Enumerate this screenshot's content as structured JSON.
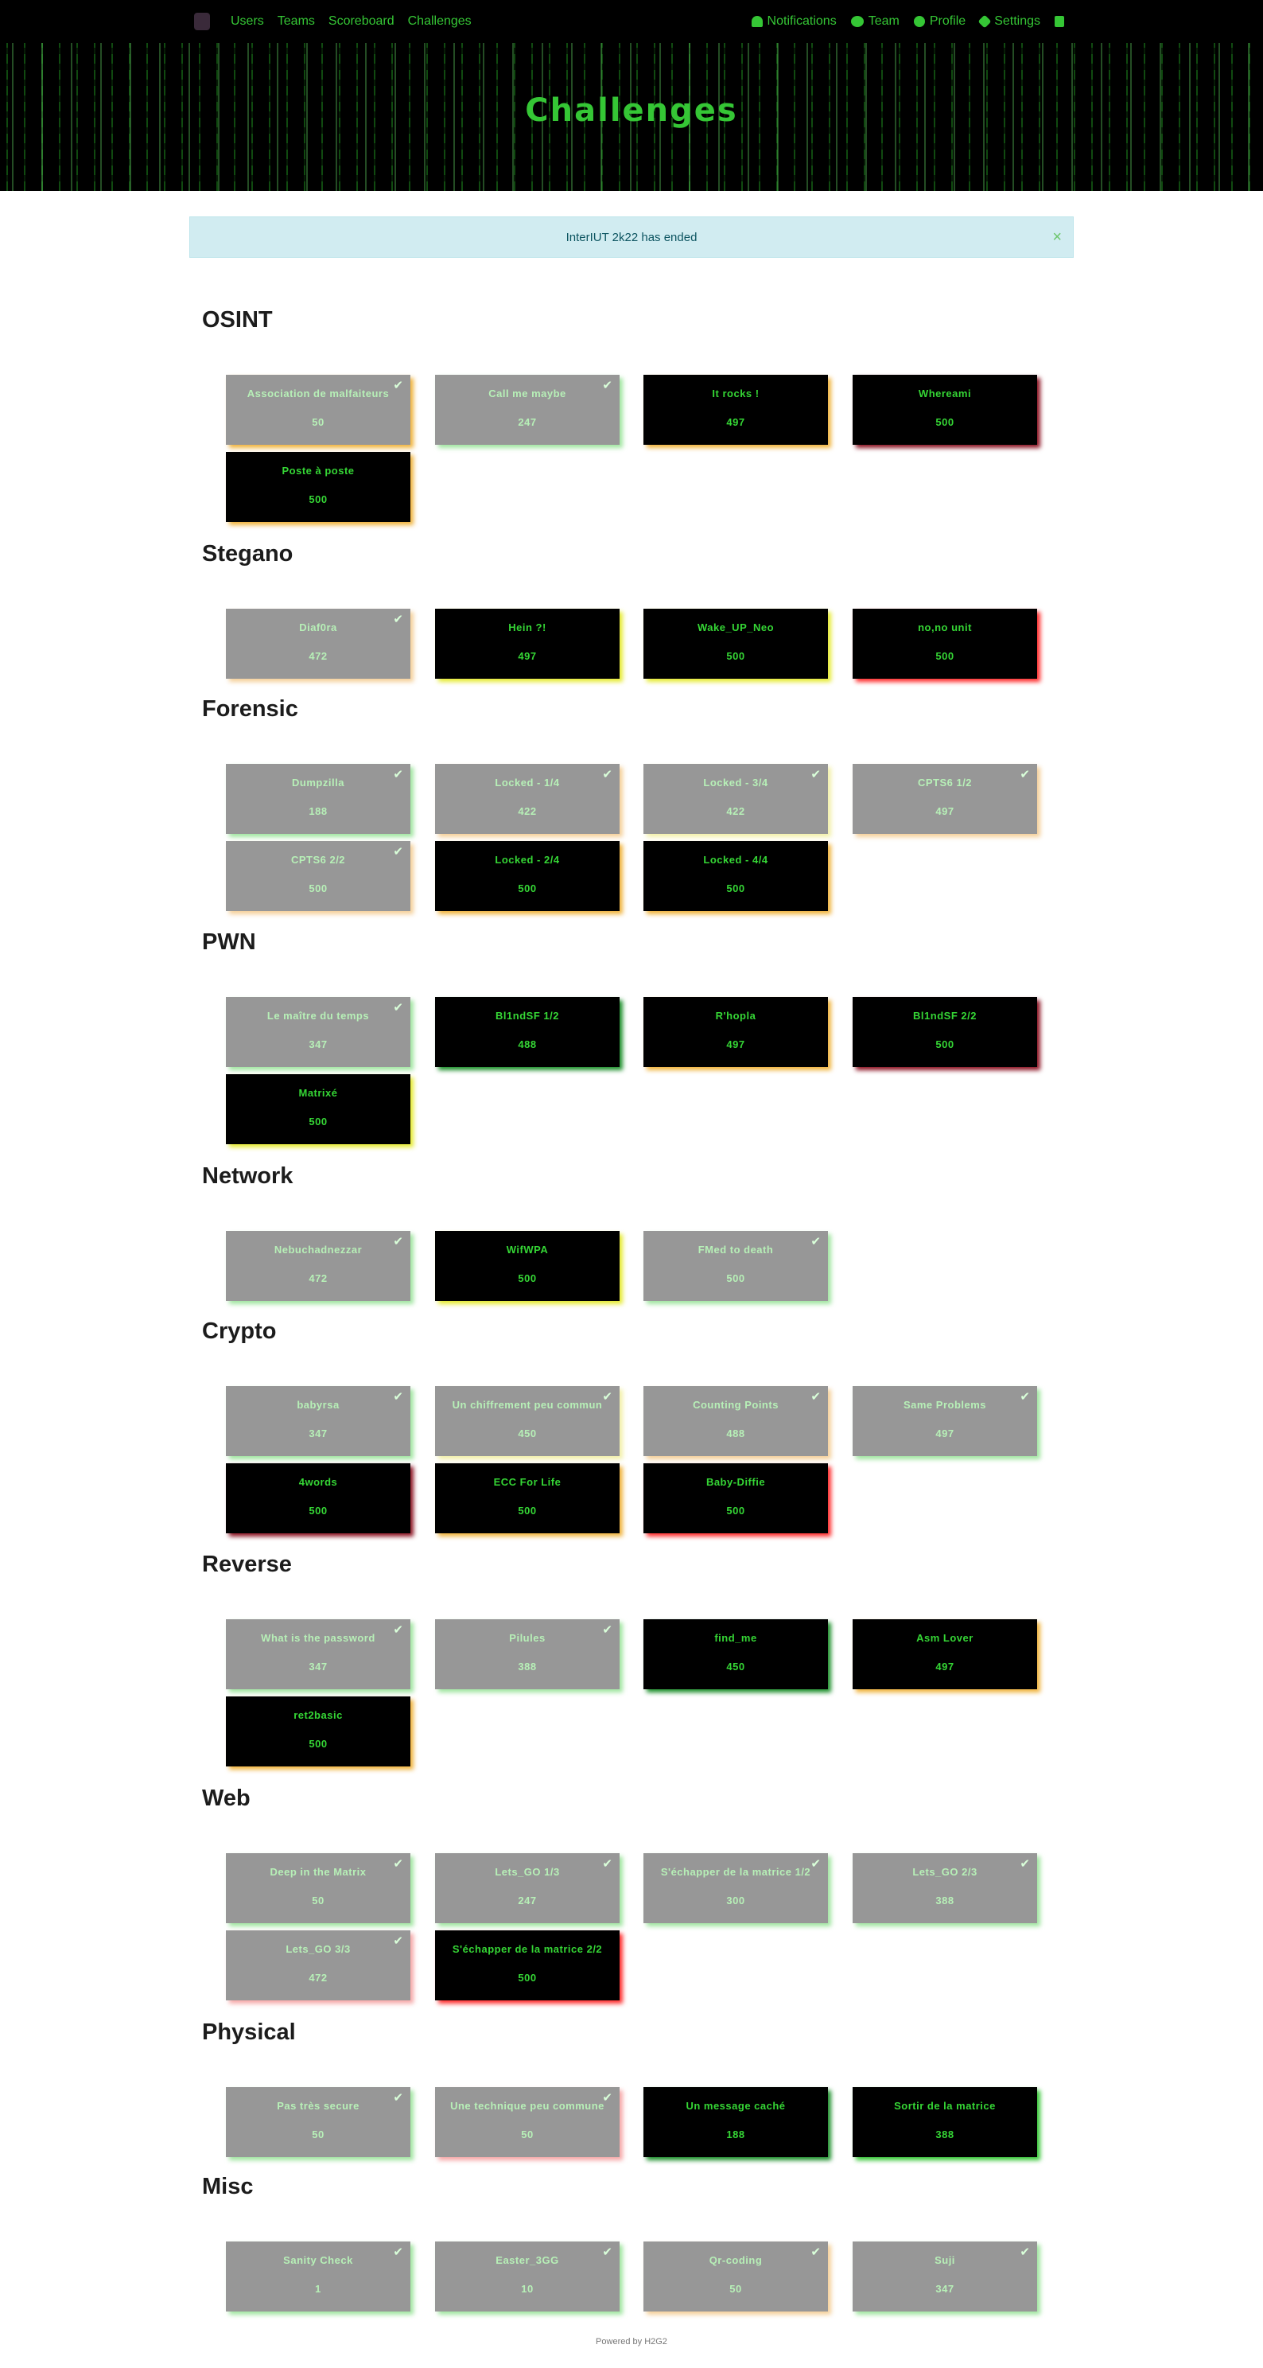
{
  "nav": {
    "left": [
      "Users",
      "Teams",
      "Scoreboard",
      "Challenges"
    ],
    "right": [
      {
        "label": "Notifications",
        "icon": "bell-icon"
      },
      {
        "label": "Team",
        "icon": "team-icon"
      },
      {
        "label": "Profile",
        "icon": "profile-icon"
      },
      {
        "label": "Settings",
        "icon": "gears-icon"
      },
      {
        "label": "",
        "icon": "logout-icon"
      }
    ]
  },
  "jumbotron": {
    "title": "Challenges"
  },
  "alert": {
    "text": "InterIUT 2k22 has ended",
    "close": "×"
  },
  "colors": {
    "solved_text": "#b7f0b7",
    "unsolved_text": "#35d635",
    "green": "#35c635",
    "yellow": "#e5ea2f",
    "orange": "#f0b23a",
    "red": "#ff2a2a",
    "darkred": "#8a1020",
    "lightgreen": "#9fe59f",
    "peach": "#f4cf98",
    "pink": "#f6a6a6",
    "darkgreen": "#1b8e2a",
    "lightyellow": "#f2f0a8"
  },
  "categories": [
    {
      "name": "OSINT",
      "challenges": [
        {
          "name": "Association de malfaiteurs",
          "value": "50",
          "solved": true,
          "glow": "orange"
        },
        {
          "name": "Call me maybe",
          "value": "247",
          "solved": true,
          "glow": "lightgreen"
        },
        {
          "name": "It rocks !",
          "value": "497",
          "solved": false,
          "glow": "orange"
        },
        {
          "name": "Whereami",
          "value": "500",
          "solved": false,
          "glow": "darkred"
        },
        {
          "name": "Poste à poste",
          "value": "500",
          "solved": false,
          "glow": "orange"
        }
      ]
    },
    {
      "name": "Stegano",
      "challenges": [
        {
          "name": "Diaf0ra",
          "value": "472",
          "solved": true,
          "glow": "peach"
        },
        {
          "name": "Hein ?!",
          "value": "497",
          "solved": false,
          "glow": "yellow"
        },
        {
          "name": "Wake_UP_Neo",
          "value": "500",
          "solved": false,
          "glow": "yellow"
        },
        {
          "name": "no,no unit",
          "value": "500",
          "solved": false,
          "glow": "red"
        }
      ]
    },
    {
      "name": "Forensic",
      "challenges": [
        {
          "name": "Dumpzilla",
          "value": "188",
          "solved": true,
          "glow": "lightgreen"
        },
        {
          "name": "Locked - 1/4",
          "value": "422",
          "solved": true,
          "glow": "peach"
        },
        {
          "name": "Locked - 3/4",
          "value": "422",
          "solved": true,
          "glow": "lightyellow"
        },
        {
          "name": "CPTS6 1/2",
          "value": "497",
          "solved": true,
          "glow": "peach"
        },
        {
          "name": "CPTS6 2/2",
          "value": "500",
          "solved": true,
          "glow": "peach"
        },
        {
          "name": "Locked - 2/4",
          "value": "500",
          "solved": false,
          "glow": "orange"
        },
        {
          "name": "Locked - 4/4",
          "value": "500",
          "solved": false,
          "glow": "orange"
        }
      ]
    },
    {
      "name": "PWN",
      "challenges": [
        {
          "name": "Le maître du temps",
          "value": "347",
          "solved": true,
          "glow": "lightgreen"
        },
        {
          "name": "Bl1ndSF 1/2",
          "value": "488",
          "solved": false,
          "glow": "darkgreen"
        },
        {
          "name": "R'hopla",
          "value": "497",
          "solved": false,
          "glow": "orange"
        },
        {
          "name": "Bl1ndSF 2/2",
          "value": "500",
          "solved": false,
          "glow": "darkred"
        },
        {
          "name": "Matrixé",
          "value": "500",
          "solved": false,
          "glow": "yellow"
        }
      ]
    },
    {
      "name": "Network",
      "challenges": [
        {
          "name": "Nebuchadnezzar",
          "value": "472",
          "solved": true,
          "glow": "lightgreen"
        },
        {
          "name": "WifWPA",
          "value": "500",
          "solved": false,
          "glow": "yellow"
        },
        {
          "name": "FMed to death",
          "value": "500",
          "solved": true,
          "glow": "lightgreen"
        }
      ]
    },
    {
      "name": "Crypto",
      "challenges": [
        {
          "name": "babyrsa",
          "value": "347",
          "solved": true,
          "glow": "lightgreen"
        },
        {
          "name": "Un chiffrement peu commun",
          "value": "450",
          "solved": true,
          "glow": "lightyellow"
        },
        {
          "name": "Counting Points",
          "value": "488",
          "solved": true,
          "glow": "peach"
        },
        {
          "name": "Same Problems",
          "value": "497",
          "solved": true,
          "glow": "lightgreen"
        },
        {
          "name": "4words",
          "value": "500",
          "solved": false,
          "glow": "darkred"
        },
        {
          "name": "ECC For Life",
          "value": "500",
          "solved": false,
          "glow": "orange"
        },
        {
          "name": "Baby-Diffie",
          "value": "500",
          "solved": false,
          "glow": "red"
        }
      ]
    },
    {
      "name": "Reverse",
      "challenges": [
        {
          "name": "What is the password",
          "value": "347",
          "solved": true,
          "glow": "lightgreen"
        },
        {
          "name": "Pilules",
          "value": "388",
          "solved": true,
          "glow": "lightgreen"
        },
        {
          "name": "find_me",
          "value": "450",
          "solved": false,
          "glow": "darkgreen"
        },
        {
          "name": "Asm Lover",
          "value": "497",
          "solved": false,
          "glow": "orange"
        },
        {
          "name": "ret2basic",
          "value": "500",
          "solved": false,
          "glow": "orange"
        }
      ]
    },
    {
      "name": "Web",
      "challenges": [
        {
          "name": "Deep in the Matrix",
          "value": "50",
          "solved": true,
          "glow": "lightgreen"
        },
        {
          "name": "Lets_GO 1/3",
          "value": "247",
          "solved": true,
          "glow": "lightgreen"
        },
        {
          "name": "S'échapper de la matrice 1/2",
          "value": "300",
          "solved": true,
          "glow": "lightgreen"
        },
        {
          "name": "Lets_GO 2/3",
          "value": "388",
          "solved": true,
          "glow": "lightgreen"
        },
        {
          "name": "Lets_GO 3/3",
          "value": "472",
          "solved": true,
          "glow": "pink"
        },
        {
          "name": "S'échapper de la matrice 2/2",
          "value": "500",
          "solved": false,
          "glow": "red"
        }
      ]
    },
    {
      "name": "Physical",
      "challenges": [
        {
          "name": "Pas très secure",
          "value": "50",
          "solved": true,
          "glow": "lightgreen"
        },
        {
          "name": "Une technique peu commune",
          "value": "50",
          "solved": true,
          "glow": "pink"
        },
        {
          "name": "Un message caché",
          "value": "188",
          "solved": false,
          "glow": "darkgreen"
        },
        {
          "name": "Sortir de la matrice",
          "value": "388",
          "solved": false,
          "glow": "green"
        }
      ]
    },
    {
      "name": "Misc",
      "challenges": [
        {
          "name": "Sanity Check",
          "value": "1",
          "solved": true,
          "glow": "lightgreen"
        },
        {
          "name": "Easter_3GG",
          "value": "10",
          "solved": true,
          "glow": "lightgreen"
        },
        {
          "name": "Qr-coding",
          "value": "50",
          "solved": true,
          "glow": "peach"
        },
        {
          "name": "Suji",
          "value": "347",
          "solved": true,
          "glow": "lightgreen"
        }
      ]
    }
  ],
  "footer": {
    "text": "Powered by H2G2"
  }
}
